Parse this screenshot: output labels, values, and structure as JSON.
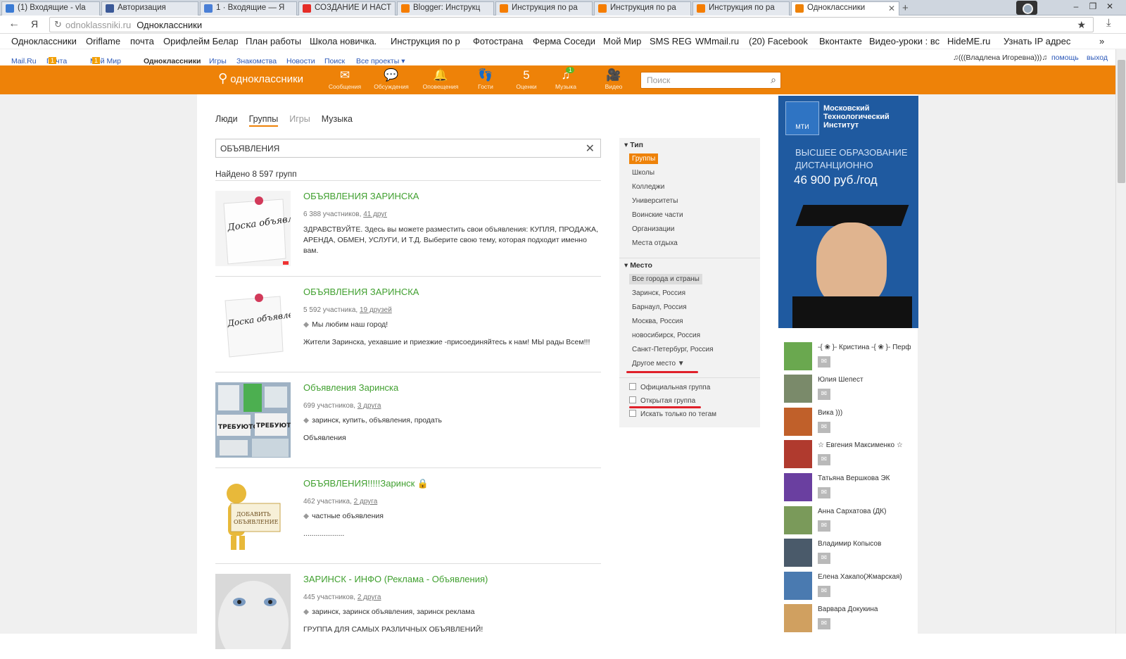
{
  "browser": {
    "tabs": [
      {
        "label": "(1) Входящие - vla",
        "color": "#3b7bd4"
      },
      {
        "label": "Авторизация",
        "color": "#3b5998"
      },
      {
        "label": "1 · Входящие — Я",
        "color": "#4a7fd6"
      },
      {
        "label": "СОЗДАНИЕ И НАСТ",
        "color": "#e52d27"
      },
      {
        "label": "Blogger: Инструкц",
        "color": "#f57d00"
      },
      {
        "label": "Инструкция по ра",
        "color": "#f57d00"
      },
      {
        "label": "Инструкция по ра",
        "color": "#f57d00"
      },
      {
        "label": "Инструкция по ра",
        "color": "#f57d00"
      },
      {
        "label": "Одноклассники",
        "color": "#ee8208"
      }
    ],
    "new_tab": "+",
    "back": "←",
    "yandex": "Я",
    "url_host": "odnoklassniki.ru",
    "page_title": "Одноклассники",
    "bookmarks": [
      "Одноклассники",
      "Oriflame",
      "почта",
      "Орифлейм Белар",
      "План работы",
      "Школа новичка.",
      "Инструкция по р",
      "Фотострана",
      "Ферма Соседи",
      "Мой Мир",
      "SMS REG",
      "WMmail.ru",
      "(20) Facebook",
      "Вконтакте",
      "Видео-уроки : вс",
      "HideME.ru",
      "Узнать IP адрес"
    ],
    "bookmarks_more": "»"
  },
  "mailru_bar": {
    "links": [
      {
        "label": "Mail.Ru",
        "count": ""
      },
      {
        "label": "Почта",
        "count": "1"
      },
      {
        "label": "Мой Мир",
        "count": "1"
      },
      {
        "label": "Одноклассники",
        "count": ""
      },
      {
        "label": "Игры",
        "count": ""
      },
      {
        "label": "Знакомства",
        "count": ""
      },
      {
        "label": "Новости",
        "count": ""
      },
      {
        "label": "Поиск",
        "count": ""
      },
      {
        "label": "Все проекты ▾",
        "count": ""
      }
    ],
    "user": "♫(((Владлена Игоревна)))♫",
    "help": "помощь",
    "logout": "выход"
  },
  "ok_header": {
    "logo": "одноклассники",
    "nav": [
      {
        "label": "Сообщения",
        "icon": "✉",
        "badge": ""
      },
      {
        "label": "Обсуждения",
        "icon": "💬",
        "badge": ""
      },
      {
        "label": "Оповещения",
        "icon": "🔔",
        "badge": ""
      },
      {
        "label": "Гости",
        "icon": "👣",
        "badge": ""
      },
      {
        "label": "Оценки",
        "icon": "5",
        "badge": ""
      },
      {
        "label": "Музыка",
        "icon": "♫",
        "badge": "1"
      },
      {
        "label": "Видео",
        "icon": "🎥",
        "badge": ""
      }
    ],
    "search_placeholder": "Поиск"
  },
  "search_tabs": [
    "Люди",
    "Группы",
    "Игры",
    "Музыка"
  ],
  "query": "ОБЪЯВЛЕНИЯ",
  "found": "Найдено 8 597 групп",
  "groups": [
    {
      "name": "ОБЪЯВЛЕНИЯ ЗАРИНСКА",
      "members": "6 388 участников,",
      "friends": "41 друг",
      "tags": "",
      "desc": "ЗДРАВСТВУЙТЕ. Здесь вы можете разместить свои объявления: КУПЛЯ, ПРОДАЖА, АРЕНДА, ОБМЕН, УСЛУГИ, И Т.Д. Выберите свою тему, которая подходит именно  вам."
    },
    {
      "name": "ОБЪЯВЛЕНИЯ ЗАРИНСКА",
      "members": "5 592 участника,",
      "friends": "19 друзей",
      "tags": "Мы любим наш город!",
      "desc": "Жители Заринска, уехавшие и приезжие -присоединяйтесь к нам! МЫ рады Всем!!!"
    },
    {
      "name": "Объявления Заринска",
      "members": "699 участников,",
      "friends": "3 друга",
      "tags": "заринск, купить, объявления, продать",
      "desc": "Объявления"
    },
    {
      "name": "ОБЪЯВЛЕНИЯ!!!!!Заринск 🔒",
      "members": "462 участника,",
      "friends": "2 друга",
      "tags": "частные объявления",
      "desc": "...................."
    },
    {
      "name": "ЗАРИНСК - ИНФО (Реклама - Объявления)",
      "members": "445 участников,",
      "friends": "2 друга",
      "tags": "заринск, заринск объявления, заринск реклама",
      "desc": "ГРУППА ДЛЯ САМЫХ РАЗЛИЧНЫХ ОБЪЯВЛЕНИЙ!"
    }
  ],
  "thumb_text": {
    "board": "Доска объявлений",
    "add_ad": "ДОБАВИТЬ ОБЪЯВЛЕНИЕ",
    "wanted": "ТРЕБУЮТСЯ"
  },
  "filter": {
    "type_header": "▾ Тип",
    "types": [
      "Группы",
      "Школы",
      "Колледжи",
      "Университеты",
      "Воинские части",
      "Организации",
      "Места отдыха"
    ],
    "place_header": "▾ Место",
    "places": [
      "Все города и страны",
      "Заринск, Россия",
      "Барнаул, Россия",
      "Москва, Россия",
      "новосибирск, Россия",
      "Санкт-Петербург, Россия",
      "Другое место ▼"
    ],
    "checkboxes": [
      "Официальная группа",
      "Открытая группа",
      "Искать только по тегам"
    ]
  },
  "ad": {
    "logo": "МТИ",
    "name": "Московский Технологический Институт",
    "slogan": "ВЫСШЕЕ ОБРАЗОВАНИЕ ДИСТАНЦИОННО",
    "price": "46 900 руб./год"
  },
  "friends": [
    {
      "name": "-{ ❀ }- Кристина -{ ❀ }- Перф...",
      "color": "#6aa84f"
    },
    {
      "name": "Юлия Шепест",
      "color": "#7a8a6a"
    },
    {
      "name": "Вика )))",
      "color": "#c0602a"
    },
    {
      "name": "☆ Евгения Максименко ☆",
      "color": "#b03a2e"
    },
    {
      "name": "Татьяна Вершкова ЭК",
      "color": "#6a3fa0"
    },
    {
      "name": "Анна Сархатова (ДК)",
      "color": "#7a9a5a"
    },
    {
      "name": "Владимир Копысов",
      "color": "#4a5a6a"
    },
    {
      "name": "Елена Хакапо(Жмарская)",
      "color": "#4a7ab0"
    },
    {
      "name": "Варвара Докукина",
      "color": "#d0a060"
    }
  ]
}
